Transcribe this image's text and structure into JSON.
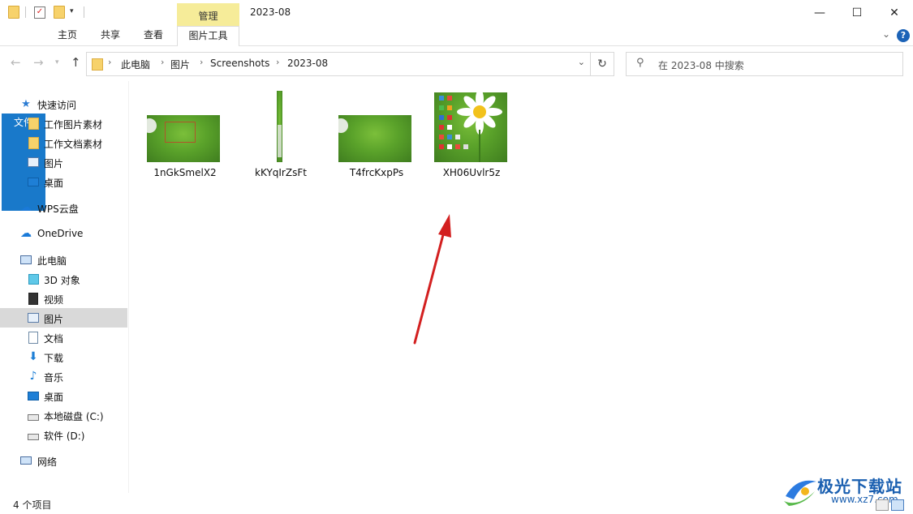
{
  "window": {
    "title": "2023-08",
    "context_tab_group": "管理",
    "controls": {
      "minimize": "—",
      "maximize": "☐",
      "close": "✕"
    }
  },
  "ribbon": {
    "tabs": [
      {
        "label": "文件",
        "style": "file"
      },
      {
        "label": "主页"
      },
      {
        "label": "共享"
      },
      {
        "label": "查看"
      },
      {
        "label": "图片工具",
        "style": "contextual"
      }
    ],
    "help": "?"
  },
  "address_bar": {
    "breadcrumbs": [
      "此电脑",
      "图片",
      "Screenshots",
      "2023-08"
    ],
    "search_placeholder": "在 2023-08 中搜索"
  },
  "sidebar": {
    "items": [
      {
        "label": "快速访问",
        "icon": "star-icon",
        "level": 0
      },
      {
        "label": "工作图片素材",
        "icon": "folder-icon",
        "level": 1
      },
      {
        "label": "工作文档素材",
        "icon": "folder-icon",
        "level": 1
      },
      {
        "label": "图片",
        "icon": "pictures-icon",
        "level": 1
      },
      {
        "label": "桌面",
        "icon": "desktop-icon",
        "level": 1
      },
      {
        "label": "WPS云盘",
        "icon": "cloud-icon",
        "level": 0
      },
      {
        "label": "OneDrive",
        "icon": "cloud-icon",
        "level": 0
      },
      {
        "label": "此电脑",
        "icon": "computer-icon",
        "level": 0
      },
      {
        "label": "3D 对象",
        "icon": "3d-objects-icon",
        "level": 1
      },
      {
        "label": "视频",
        "icon": "video-icon",
        "level": 1
      },
      {
        "label": "图片",
        "icon": "pictures-icon",
        "level": 1,
        "selected": true
      },
      {
        "label": "文档",
        "icon": "document-icon",
        "level": 1
      },
      {
        "label": "下载",
        "icon": "download-icon",
        "level": 1
      },
      {
        "label": "音乐",
        "icon": "music-icon",
        "level": 1
      },
      {
        "label": "桌面",
        "icon": "desktop-icon",
        "level": 1
      },
      {
        "label": "本地磁盘 (C:)",
        "icon": "drive-icon",
        "level": 1
      },
      {
        "label": "软件 (D:)",
        "icon": "drive-icon",
        "level": 1
      },
      {
        "label": "网络",
        "icon": "network-icon",
        "level": 0
      }
    ]
  },
  "files": [
    {
      "name": "1nGkSmelX2"
    },
    {
      "name": "kKYqIrZsFt"
    },
    {
      "name": "T4frcKxpPs"
    },
    {
      "name": "XH06Uvlr5z"
    }
  ],
  "status_bar": {
    "item_count": "4 个项目"
  },
  "watermark": {
    "title": "极光下载站",
    "url": "www.xz7.com"
  },
  "colors": {
    "file_tab": "#1979ca",
    "manage_tab": "#f6ec99",
    "selection": "#d9d9d9",
    "arrow": "#d32020"
  }
}
